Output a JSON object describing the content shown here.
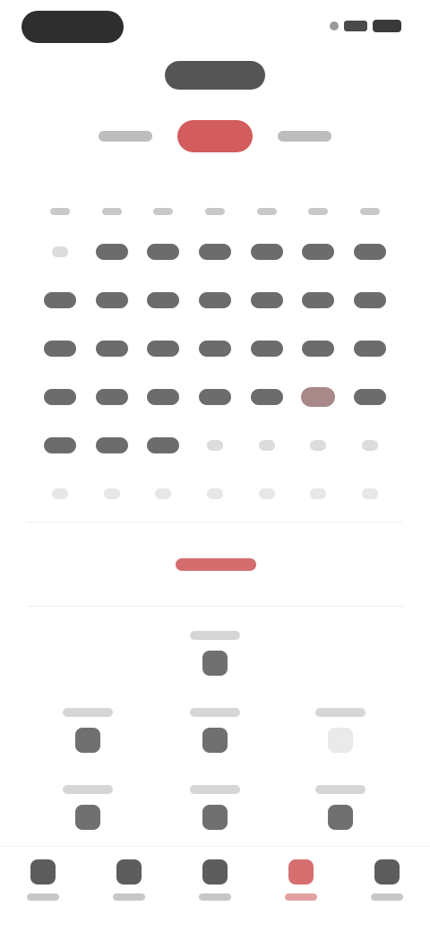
{
  "status_bar": {
    "signal_icon": "signal-icon",
    "battery_icon": "battery-icon"
  },
  "header": {
    "title": ""
  },
  "segments": [
    {
      "label": ""
    },
    {
      "label": ""
    },
    {
      "label": ""
    }
  ],
  "calendar": {
    "weekday_labels": [
      "",
      "",
      "",
      "",
      "",
      "",
      ""
    ],
    "weeks": [
      [
        "",
        "",
        "",
        "",
        "",
        "",
        ""
      ],
      [
        "",
        "",
        "",
        "",
        "",
        "",
        ""
      ],
      [
        "",
        "",
        "",
        "",
        "",
        "",
        ""
      ],
      [
        "",
        "",
        "",
        "",
        "",
        "",
        ""
      ],
      [
        "",
        "",
        "",
        "",
        "",
        "",
        ""
      ],
      [
        "",
        "",
        "",
        "",
        "",
        "",
        ""
      ]
    ]
  },
  "today_link": {
    "label": ""
  },
  "quick_actions": [
    {
      "label": "",
      "icon": "icon-1"
    },
    {
      "label": "",
      "icon": "icon-2"
    },
    {
      "label": "",
      "icon": "icon-3"
    },
    {
      "label": "",
      "icon": "icon-4"
    },
    {
      "label": "",
      "icon": "icon-5"
    },
    {
      "label": "",
      "icon": "icon-6"
    },
    {
      "label": "",
      "icon": "icon-7"
    }
  ],
  "tabbar": [
    {
      "label": "",
      "icon": "tab-1-icon"
    },
    {
      "label": "",
      "icon": "tab-2-icon"
    },
    {
      "label": "",
      "icon": "tab-3-icon"
    },
    {
      "label": "",
      "icon": "tab-4-icon"
    },
    {
      "label": "",
      "icon": "tab-5-icon"
    }
  ],
  "colors": {
    "accent": "#d35c5c",
    "dark": "#6c6c6c",
    "muted": "#d6d6d6",
    "today_cell": "#a88888"
  }
}
